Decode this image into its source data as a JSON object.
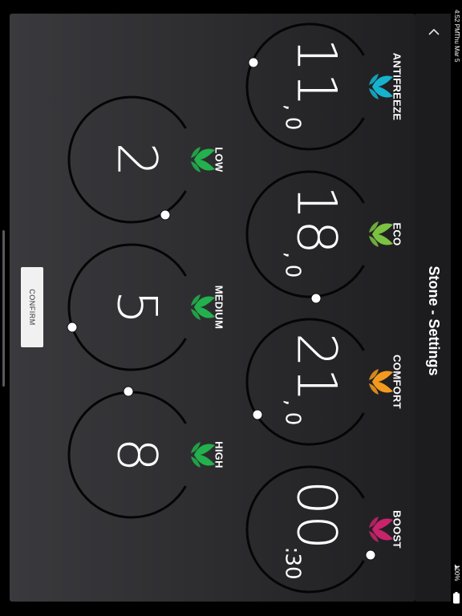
{
  "status_bar": {
    "time": "4:52 PM",
    "date": "Thu Mar 5",
    "battery": "100%"
  },
  "header": {
    "title": "Stone - Settings",
    "back_icon": "chevron-left-icon"
  },
  "temperature_dials": [
    {
      "label": "ANTIFREEZE",
      "value_main": "11",
      "value_sep": ",",
      "value_small": "0",
      "leaf_color": "#16b3cf"
    },
    {
      "label": "ECO",
      "value_main": "18",
      "value_sep": ",",
      "value_small": "0",
      "leaf_color": "#7cc242"
    },
    {
      "label": "COMFORT",
      "value_main": "21",
      "value_sep": ",",
      "value_small": "0",
      "leaf_color": "#f39a1e"
    },
    {
      "label": "BOOST",
      "value_main": "00",
      "value_sep": ":",
      "value_small": "30",
      "leaf_color": "#c8236b"
    }
  ],
  "level_dials": [
    {
      "label": "LOW",
      "value_main": "2",
      "leaf_color": "#22b14c"
    },
    {
      "label": "MEDIUM",
      "value_main": "5",
      "leaf_color": "#22b14c"
    },
    {
      "label": "HIGH",
      "value_main": "8",
      "leaf_color": "#22b14c"
    }
  ],
  "confirm_button": {
    "label": "CONFIRM"
  }
}
